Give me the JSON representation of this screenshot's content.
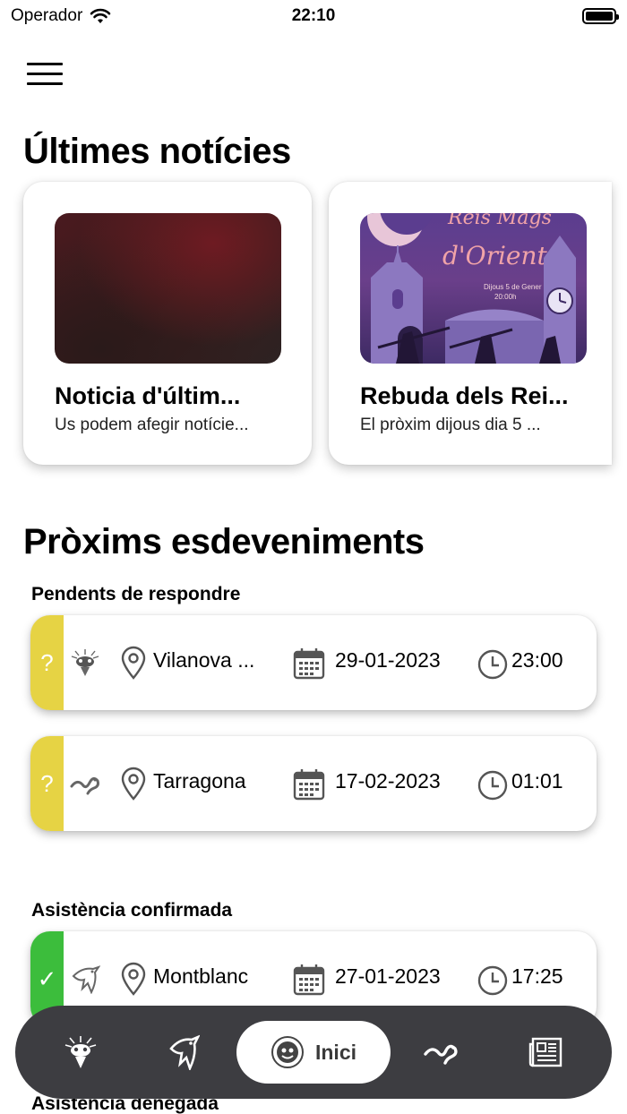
{
  "status_bar": {
    "carrier": "Operador",
    "time": "22:10"
  },
  "news": {
    "title": "Últimes notícies",
    "items": [
      {
        "title": "Noticia d'últim...",
        "excerpt": "Us podem afegir notície..."
      },
      {
        "title": "Rebuda dels Rei...",
        "excerpt": "El pròxim dijous dia 5 ...",
        "poster": {
          "heading_1": "Reis Mags",
          "heading_2": "d'Orient",
          "date_line": "Dijous 5 de Gener",
          "time_line": "20:00h"
        }
      }
    ]
  },
  "events": {
    "title": "Pròxims esdeveniments",
    "pending": {
      "title": "Pendents de respondre",
      "items": [
        {
          "status_symbol": "?",
          "org_icon": "sun-figure-icon",
          "place": "Vilanova ...",
          "date": "29-01-2023",
          "time": "23:00"
        },
        {
          "status_symbol": "?",
          "org_icon": "serpent-icon",
          "place": "Tarragona",
          "date": "17-02-2023",
          "time": "01:01"
        }
      ]
    },
    "confirmed": {
      "title": "Asistència confirmada",
      "items": [
        {
          "status_symbol": "✓",
          "org_icon": "eagle-icon",
          "place": "Montblanc",
          "date": "27-01-2023",
          "time": "17:25"
        }
      ]
    },
    "denied": {
      "title": "Asistència denegada"
    }
  },
  "tab_bar": {
    "tabs": [
      "sun-figure-icon",
      "eagle-icon",
      "home-emblem-icon",
      "serpent-icon",
      "newspaper-icon"
    ],
    "active_label": "Inici"
  },
  "colors": {
    "pending": "#e6d344",
    "confirmed": "#3cbd3c",
    "tab_bar": "#3d3d41"
  }
}
